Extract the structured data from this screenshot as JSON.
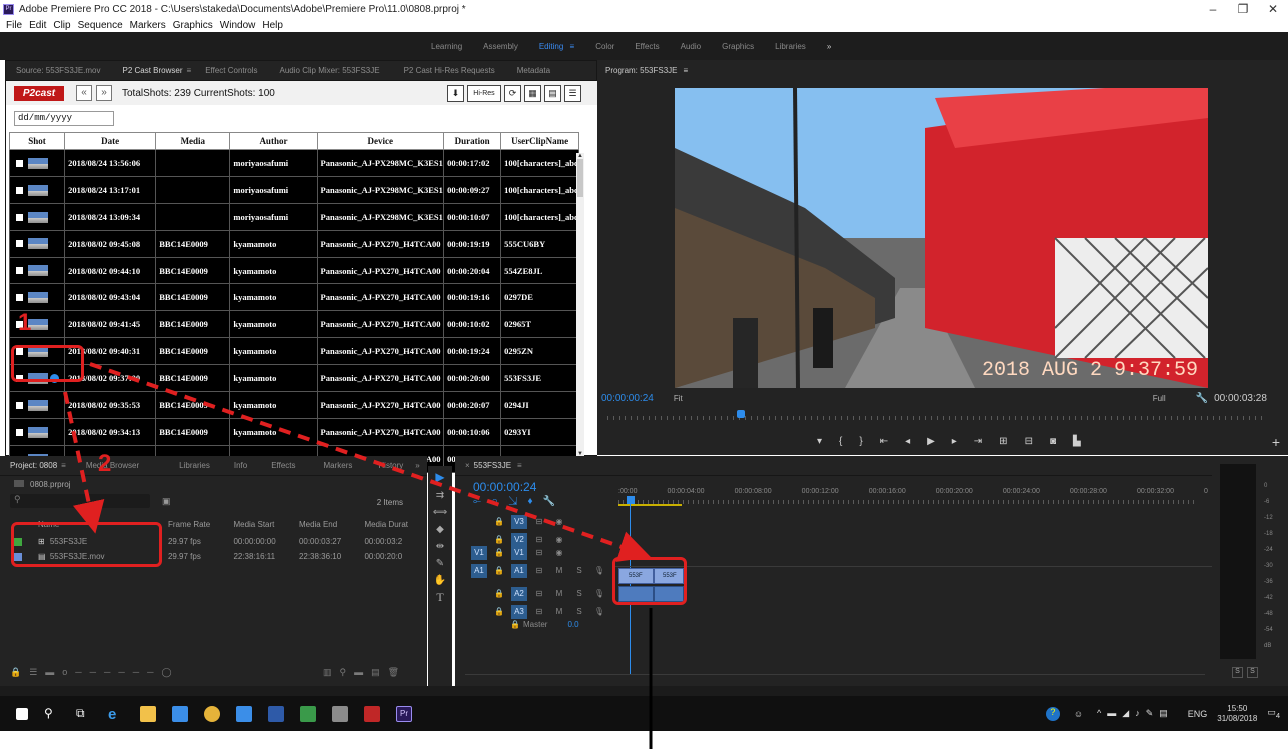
{
  "title_bar": {
    "text": "Adobe Premiere Pro CC 2018 - C:\\Users\\stakeda\\Documents\\Adobe\\Premiere Pro\\11.0\\0808.prproj *",
    "controls": [
      "–",
      "❐",
      "✕"
    ]
  },
  "menu": [
    "File",
    "Edit",
    "Clip",
    "Sequence",
    "Markers",
    "Graphics",
    "Window",
    "Help"
  ],
  "workspaces": {
    "items": [
      "Learning",
      "Assembly",
      "Editing",
      "Color",
      "Effects",
      "Audio",
      "Graphics",
      "Libraries"
    ],
    "active": "Editing",
    "more": "»",
    "menu_icon": "≡"
  },
  "source_tabs": [
    "Source: 553FS3JE.mov",
    "P2 Cast Browser",
    "≡",
    "Effect Controls",
    "Audio Clip Mixer: 553FS3JE",
    "P2 Cast Hi-Res Requests",
    "Metadata"
  ],
  "p2": {
    "logo": "P2cast",
    "prev": "«",
    "next": "»",
    "shot_info": "TotalShots: 239 CurrentShots: 100",
    "date_placeholder": "dd/mm/yyyy",
    "hires_label": "Hi-Res",
    "scroll_up": "▲",
    "scroll_down": "▼"
  },
  "table": {
    "columns": [
      "Shot",
      "Date",
      "Media",
      "Author",
      "Device",
      "Duration",
      "UserClipName"
    ],
    "rows": [
      [
        "",
        "2018/08/24 13:56:06",
        "",
        "moriyaosafumi",
        "Panasonic_AJ-PX298MC_K3ES1",
        "00:00:17:02",
        "100[characters]_abc"
      ],
      [
        "",
        "2018/08/24 13:17:01",
        "",
        "moriyaosafumi",
        "Panasonic_AJ-PX298MC_K3ES1",
        "00:00:09:27",
        "100[characters]_abc"
      ],
      [
        "",
        "2018/08/24 13:09:34",
        "",
        "moriyaosafumi",
        "Panasonic_AJ-PX298MC_K3ES1",
        "00:00:10:07",
        "100[characters]_abc"
      ],
      [
        "",
        "2018/08/02 09:45:08",
        "BBC14E0009",
        "kyamamoto",
        "Panasonic_AJ-PX270_H4TCA00",
        "00:00:19:19",
        "555CU6BY"
      ],
      [
        "",
        "2018/08/02 09:44:10",
        "BBC14E0009",
        "kyamamoto",
        "Panasonic_AJ-PX270_H4TCA00",
        "00:00:20:04",
        "554ZE8JL"
      ],
      [
        "",
        "2018/08/02 09:43:04",
        "BBC14E0009",
        "kyamamoto",
        "Panasonic_AJ-PX270_H4TCA00",
        "00:00:19:16",
        "0297DE"
      ],
      [
        "",
        "2018/08/02 09:41:45",
        "BBC14E0009",
        "kyamamoto",
        "Panasonic_AJ-PX270_H4TCA00",
        "00:00:10:02",
        "02965T"
      ],
      [
        "",
        "2018/08/02 09:40:31",
        "BBC14E0009",
        "kyamamoto",
        "Panasonic_AJ-PX270_H4TCA00",
        "00:00:19:24",
        "0295ZN"
      ],
      [
        "",
        "2018/08/02 09:37:00",
        "BBC14E0009",
        "kyamamoto",
        "Panasonic_AJ-PX270_H4TCA00",
        "00:00:20:00",
        "553FS3JE"
      ],
      [
        "",
        "2018/08/02 09:35:53",
        "BBC14E0009",
        "kyamamoto",
        "Panasonic_AJ-PX270_H4TCA00",
        "00:00:20:07",
        "0294JI"
      ],
      [
        "",
        "2018/08/02 09:34:13",
        "BBC14E0009",
        "kyamamoto",
        "Panasonic_AJ-PX270_H4TCA00",
        "00:00:10:06",
        "0293YI"
      ],
      [
        "",
        "2018/08/02 09:32:59",
        "BBC14E0009",
        "kyamamoto",
        "Panasonic_AJ-PX270_H4TCA00",
        "00:00:10:04",
        "029237"
      ]
    ],
    "selected_row": 8
  },
  "program": {
    "tab": "Program: 553FS3JE",
    "menu_icon": "≡",
    "timecode": "00:00:00:24",
    "fit": "Fit",
    "full": "Full",
    "duration": "00:00:03:28",
    "date_stamp": "2018 AUG 2 9:37:59"
  },
  "project": {
    "tabs": [
      "Project: 0808",
      "≡",
      "Media Browser",
      "Libraries",
      "Info",
      "Effects",
      "Markers",
      "History",
      "»"
    ],
    "file": "0808.prproj",
    "items_count": "2 Items",
    "columns": [
      "Name",
      "Frame Rate",
      "Media Start",
      "Media End",
      "Media Durat"
    ],
    "items": [
      {
        "name": "553FS3JE",
        "fps": "29.97 fps",
        "start": "00:00:00:00",
        "end": "00:00:03:27",
        "dur": "00:00:03:2"
      },
      {
        "name": "553FS3JE.mov",
        "fps": "29.97 fps",
        "start": "22:38:16:11",
        "end": "22:38:36:10",
        "dur": "00:00:20:0"
      }
    ]
  },
  "sequence": {
    "tab": "553FS3JE",
    "menu_icon": "≡",
    "timecode": "00:00:00:24",
    "ruler": [
      ":00:00",
      "00:00:04:00",
      "00:00:08:00",
      "00:00:12:00",
      "00:00:16:00",
      "00:00:20:00",
      "00:00:24:00",
      "00:00:28:00",
      "00:00:32:00",
      "0"
    ],
    "tracks": [
      "V3",
      "V2",
      "V1",
      "A1",
      "A2",
      "A3"
    ],
    "master": "Master",
    "master_value": "0.0",
    "clip_label": "553F"
  },
  "meter": {
    "labels": [
      "0",
      "-6",
      "-12",
      "-18",
      "-24",
      "-30",
      "-36",
      "-42",
      "-48",
      "-54",
      "dB"
    ],
    "solo": [
      "S",
      "S"
    ]
  },
  "taskbar": {
    "time": "15:50",
    "date": "31/08/2018",
    "lang": "ENG",
    "notify": "4"
  },
  "annotations": {
    "one": "1",
    "two": "2"
  }
}
